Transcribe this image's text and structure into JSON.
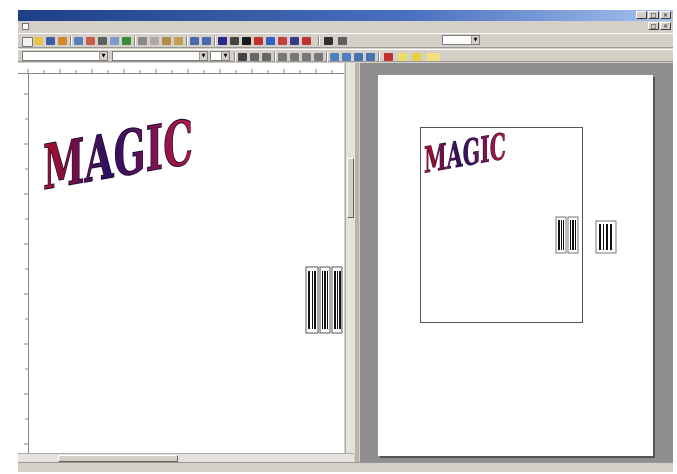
{
  "window": {
    "title": ""
  },
  "menu": {
    "items": [
      "",
      "",
      "",
      "",
      "",
      "",
      "",
      "",
      "",
      "",
      ""
    ]
  },
  "toolbar": {
    "zoom": "",
    "style_combo": "",
    "font_combo": "",
    "size_combo": ""
  },
  "document": {
    "logo_text": "MAGIC",
    "field_text": ""
  },
  "preview": {
    "logo_text": "MAGIC",
    "field_text": ""
  },
  "status": {
    "page": "",
    "zoom": "",
    "mode": "",
    "words": "",
    "extra": ""
  },
  "colors": {
    "title_bar": "#1c3f86",
    "logo_dark": "#2a1060",
    "logo_red": "#b0102a",
    "barcode_border": "#555555"
  },
  "icons": [
    "new-icon",
    "open-icon",
    "save-icon",
    "print-icon",
    "preview-icon",
    "cut-icon",
    "copy-icon",
    "paste-icon",
    "undo-icon",
    "redo-icon",
    "table-icon",
    "draw-icon",
    "zoom-icon",
    "bold-icon",
    "italic-icon",
    "underline-icon",
    "align-left-icon",
    "align-center-icon",
    "align-right-icon",
    "justify-icon",
    "font-color-icon",
    "highlight-icon"
  ]
}
